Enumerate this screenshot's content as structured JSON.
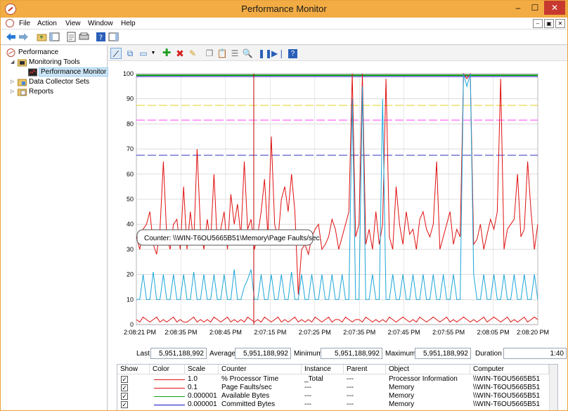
{
  "window": {
    "title": "Performance Monitor",
    "min": "–",
    "max": "☐",
    "close": "✕"
  },
  "menu": [
    "File",
    "Action",
    "View",
    "Window",
    "Help"
  ],
  "mdi": {
    "min": "–",
    "restore": "▣",
    "close": "✕"
  },
  "tree": {
    "root": "Performance",
    "monitoring": "Monitoring Tools",
    "perfmon": "Performance Monitor",
    "dcs": "Data Collector Sets",
    "reports": "Reports"
  },
  "tooltip": "Counter: \\\\WIN-T6OU5665B51\\Memory\\Page Faults/sec.",
  "stats": {
    "last_label": "Last",
    "last": "5,951,188,992",
    "avg_label": "Average",
    "avg": "5,951,188,992",
    "min_label": "Minimum",
    "min": "5,951,188,992",
    "max_label": "Maximum",
    "max": "5,951,188,992",
    "dur_label": "Duration",
    "dur": "1:40"
  },
  "legend": {
    "headers": [
      "Show",
      "Color",
      "Scale",
      "Counter",
      "Instance",
      "Parent",
      "Object",
      "Computer"
    ],
    "rows": [
      {
        "show": "✓",
        "color": "#e01010",
        "scale": "1.0",
        "counter": "% Processor Time",
        "instance": "_Total",
        "parent": "---",
        "object": "Processor Information",
        "computer": "\\\\WIN-T6OU5665B51"
      },
      {
        "show": "✓",
        "color": "#e01010",
        "scale": "0.1",
        "counter": "Page Faults/sec",
        "instance": "---",
        "parent": "---",
        "object": "Memory",
        "computer": "\\\\WIN-T6OU5665B51"
      },
      {
        "show": "✓",
        "color": "#10a010",
        "scale": "0.000001",
        "counter": "Available Bytes",
        "instance": "---",
        "parent": "---",
        "object": "Memory",
        "computer": "\\\\WIN-T6OU5665B51"
      },
      {
        "show": "✓",
        "color": "#1010c0",
        "scale": "0.000001",
        "counter": "Committed Bytes",
        "instance": "---",
        "parent": "---",
        "object": "Memory",
        "computer": "\\\\WIN-T6OU5665B51"
      }
    ]
  },
  "chart_data": {
    "type": "line",
    "ylim": [
      0,
      100
    ],
    "yticks": [
      0,
      10,
      20,
      30,
      40,
      50,
      60,
      70,
      80,
      90,
      100
    ],
    "xticks": [
      "2:08:21 PM",
      "2:08:35 PM",
      "2:08:45 PM",
      "2:07:15 PM",
      "2:07:25 PM",
      "2:07:35 PM",
      "2:07:45 PM",
      "2:07:55 PM",
      "2:08:05 PM",
      "2:08:20 PM"
    ],
    "grid": true,
    "series": [
      {
        "name": "Page Faults/sec",
        "color": "#e01010",
        "values": [
          35,
          30,
          38,
          40,
          45,
          32,
          28,
          38,
          65,
          35,
          30,
          40,
          42,
          30,
          55,
          30,
          45,
          32,
          70,
          38,
          30,
          42,
          33,
          60,
          32,
          38,
          45,
          30,
          52,
          40,
          48,
          35,
          65,
          38,
          42,
          30,
          36,
          45,
          58,
          35,
          75,
          40,
          34,
          50,
          55,
          45,
          60,
          45,
          12,
          30,
          32,
          28,
          35,
          38,
          40,
          30,
          32,
          35,
          42,
          38,
          30,
          35,
          40,
          45,
          100,
          35,
          40,
          100,
          32,
          38,
          30,
          45,
          32,
          40,
          98,
          35,
          30,
          55,
          40,
          32,
          45,
          36,
          38,
          30,
          42,
          45,
          38,
          35,
          40,
          65,
          30,
          35,
          40,
          45,
          32,
          38,
          35,
          100,
          98,
          100,
          32,
          34,
          40,
          30,
          36,
          42,
          38,
          45,
          98,
          30,
          38,
          40,
          42,
          60,
          35,
          38,
          65,
          45,
          30,
          40
        ]
      },
      {
        "name": "Processor Time",
        "color": "#e01010",
        "values": [
          2,
          1,
          3,
          2,
          1,
          2,
          3,
          1,
          2,
          1,
          2,
          3,
          1,
          2,
          1,
          1,
          2,
          3,
          1,
          2,
          1,
          2,
          1,
          3,
          2,
          1,
          2,
          3,
          1,
          2,
          1,
          2,
          1,
          3,
          2,
          1,
          2,
          1,
          3,
          2,
          1,
          2,
          3,
          1,
          2,
          1,
          2,
          3,
          1,
          2,
          1,
          2,
          1,
          3,
          2,
          1,
          2,
          3,
          1,
          2,
          2,
          1,
          3,
          2,
          1,
          2,
          2,
          1,
          3,
          2,
          1,
          2,
          1,
          2,
          1,
          3,
          2,
          1,
          2,
          3,
          2,
          1,
          2,
          1,
          3,
          2,
          1,
          2,
          3,
          2,
          1,
          2,
          3,
          1,
          2,
          1,
          2,
          3,
          2,
          1,
          2,
          1,
          2,
          3,
          1,
          2,
          3,
          2,
          1,
          2,
          3,
          1,
          2,
          1,
          2,
          3,
          1,
          2,
          3,
          2
        ]
      },
      {
        "name": "Cyan",
        "color": "#1aa6d8",
        "values": [
          10,
          10,
          20,
          10,
          10,
          21,
          10,
          10,
          20,
          10,
          10,
          20,
          10,
          10,
          20,
          10,
          10,
          21,
          10,
          10,
          20,
          10,
          10,
          20,
          10,
          10,
          20,
          10,
          10,
          22,
          10,
          10,
          15,
          18,
          22,
          10,
          10,
          20,
          10,
          10,
          20,
          10,
          10,
          20,
          10,
          10,
          21,
          10,
          10,
          20,
          10,
          10,
          20,
          10,
          10,
          20,
          10,
          10,
          20,
          10,
          10,
          20,
          10,
          10,
          90,
          10,
          10,
          95,
          10,
          10,
          20,
          10,
          10,
          90,
          10,
          10,
          20,
          10,
          10,
          20,
          10,
          10,
          20,
          10,
          10,
          20,
          10,
          10,
          20,
          10,
          10,
          20,
          10,
          10,
          20,
          10,
          10,
          100,
          95,
          100,
          20,
          10,
          10,
          20,
          10,
          10,
          20,
          10,
          10,
          20,
          10,
          10,
          20,
          10,
          10,
          20,
          10,
          10,
          20,
          10
        ]
      }
    ]
  }
}
